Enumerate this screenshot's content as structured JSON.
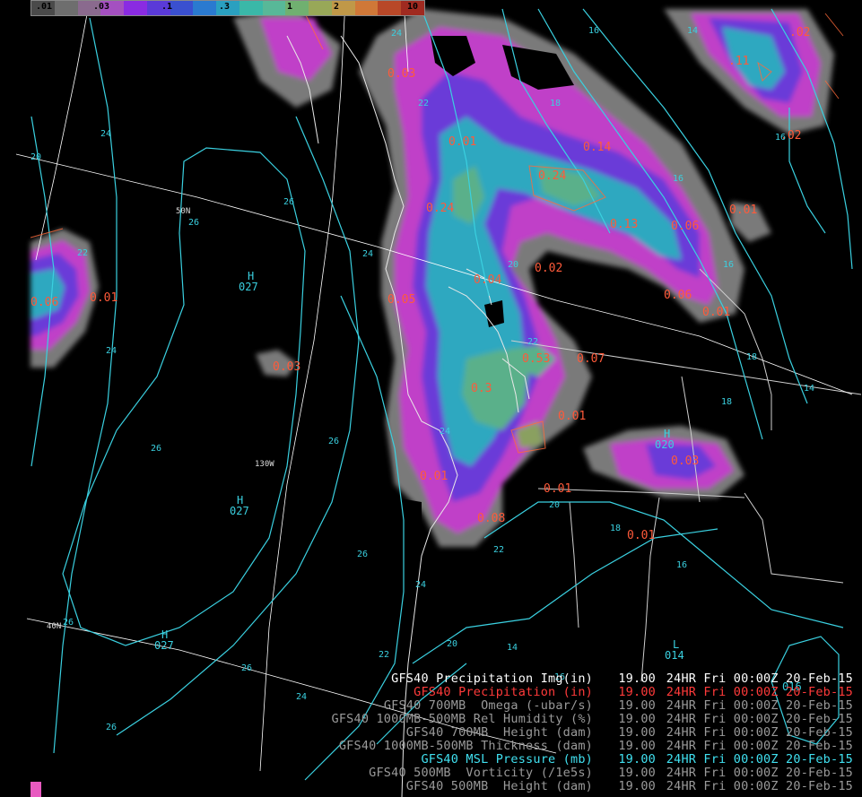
{
  "colorbar": {
    "colors": [
      "#4a4a4a",
      "#6e6e6e",
      "#8a6a8e",
      "#a450c0",
      "#8a2be2",
      "#5a3ad8",
      "#3a50d0",
      "#2a7ad0",
      "#2aa0c0",
      "#3ab8a8",
      "#58b898",
      "#70b070",
      "#98a858",
      "#c09848",
      "#d07838",
      "#b84828",
      "#a02a20"
    ],
    "labels": [
      ".01",
      ".03",
      ".1",
      ".3",
      "1",
      "2",
      "10"
    ]
  },
  "precip_labels": [
    ".02",
    ".11",
    "0.03",
    ".02",
    "0.14",
    "0.24",
    "0.24",
    "0.13",
    "0.06",
    "0.01",
    "0.02",
    "0.04",
    "0.05",
    "0.06",
    "0.01",
    "0.03",
    "0.53",
    "0.07",
    "0.3",
    "0.01",
    "0.01",
    "0.03",
    "0.01",
    "0.08",
    "0.01",
    "0.06",
    "0.01",
    "0.01"
  ],
  "contours": {
    "labels": [
      "20",
      "24",
      "26",
      "26",
      "26",
      "26",
      "26",
      "26",
      "26",
      "26",
      "24",
      "24",
      "22",
      "24",
      "22",
      "20",
      "18",
      "18",
      "16",
      "16",
      "14",
      "16",
      "24",
      "20",
      "22",
      "18",
      "16",
      "14",
      "18",
      "20",
      "22",
      "24",
      "14",
      "16",
      "16",
      "22",
      "24"
    ],
    "centers": [
      {
        "letter": "H",
        "value": "027"
      },
      {
        "letter": "H",
        "value": "027"
      },
      {
        "letter": "H",
        "value": "027"
      },
      {
        "letter": "H",
        "value": "020"
      },
      {
        "letter": "L",
        "value": "014"
      },
      {
        "letter": "",
        "value": "016"
      }
    ],
    "lat_labels": [
      "50N",
      "40N"
    ],
    "lon_labels": [
      "130W"
    ]
  },
  "legend": [
    {
      "name": "GFS40 Precipitation Img(in)",
      "value": "19.00",
      "time": "24HR Fri 00:00Z 20-Feb-15",
      "color": "#ffffff"
    },
    {
      "name": "GFS40 Precipitation (in)",
      "value": "19.00",
      "time": "24HR Fri 00:00Z 20-Feb-15",
      "color": "#ff3a3a"
    },
    {
      "name": "GFS40 700MB  Omega (-ubar/s)",
      "value": "19.00",
      "time": "24HR Fri 00:00Z 20-Feb-15",
      "color": "#9a9a9a"
    },
    {
      "name": "GFS40 1000MB-500MB Rel Humidity (%)",
      "value": "19.00",
      "time": "24HR Fri 00:00Z 20-Feb-15",
      "color": "#9a9a9a"
    },
    {
      "name": "GFS40 700MB  Height (dam)",
      "value": "19.00",
      "time": "24HR Fri 00:00Z 20-Feb-15",
      "color": "#9a9a9a"
    },
    {
      "name": "GFS40 1000MB-500MB Thickness (dam)",
      "value": "19.00",
      "time": "24HR Fri 00:00Z 20-Feb-15",
      "color": "#9a9a9a"
    },
    {
      "name": "GFS40 MSL Pressure (mb)",
      "value": "19.00",
      "time": "24HR Fri 00:00Z 20-Feb-15",
      "color": "#40e0f0"
    },
    {
      "name": "GFS40 500MB  Vorticity (/1e5s)",
      "value": "19.00",
      "time": "24HR Fri 00:00Z 20-Feb-15",
      "color": "#9a9a9a"
    },
    {
      "name": "GFS40 500MB  Height (dam)",
      "value": "19.00",
      "time": "24HR Fri 00:00Z 20-Feb-15",
      "color": "#9a9a9a"
    }
  ]
}
